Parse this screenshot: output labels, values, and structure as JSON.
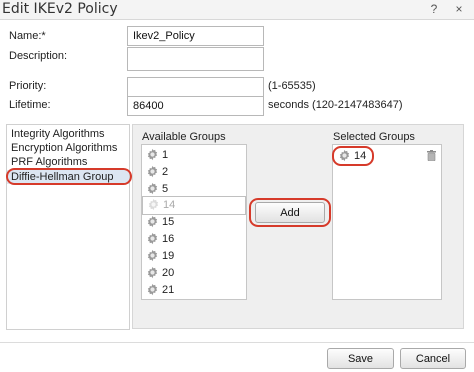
{
  "window": {
    "title": "Edit IKEv2 Policy",
    "help_icon": "help-icon",
    "close_icon": "close-icon",
    "help_glyph": "?",
    "close_glyph": "×"
  },
  "form": {
    "name_label": "Name:*",
    "name_value": "Ikev2_Policy",
    "description_label": "Description:",
    "description_value": "",
    "priority_label": "Priority:",
    "priority_value": "",
    "priority_hint": "(1-65535)",
    "lifetime_label": "Lifetime:",
    "lifetime_value": "86400",
    "lifetime_hint": "seconds (120-2147483647)"
  },
  "nav": {
    "items": [
      {
        "label": "Integrity Algorithms",
        "selected": false
      },
      {
        "label": "Encryption Algorithms",
        "selected": false
      },
      {
        "label": "PRF Algorithms",
        "selected": false
      },
      {
        "label": "Diffie-Hellman Group",
        "selected": true
      }
    ]
  },
  "available": {
    "label": "Available Groups",
    "items": [
      {
        "value": "1",
        "dim": false
      },
      {
        "value": "2",
        "dim": false
      },
      {
        "value": "5",
        "dim": false
      },
      {
        "value": "14",
        "dim": true
      },
      {
        "value": "15",
        "dim": false
      },
      {
        "value": "16",
        "dim": false
      },
      {
        "value": "19",
        "dim": false
      },
      {
        "value": "20",
        "dim": false
      },
      {
        "value": "21",
        "dim": false
      }
    ]
  },
  "selected": {
    "label": "Selected Groups",
    "items": [
      {
        "value": "14"
      }
    ],
    "remove_icon": "trash-icon"
  },
  "buttons": {
    "add": "Add",
    "save": "Save",
    "cancel": "Cancel"
  },
  "colors": {
    "highlight": "#d63a2a",
    "nav_selected": "#dce6f2",
    "panel": "#efefef"
  }
}
